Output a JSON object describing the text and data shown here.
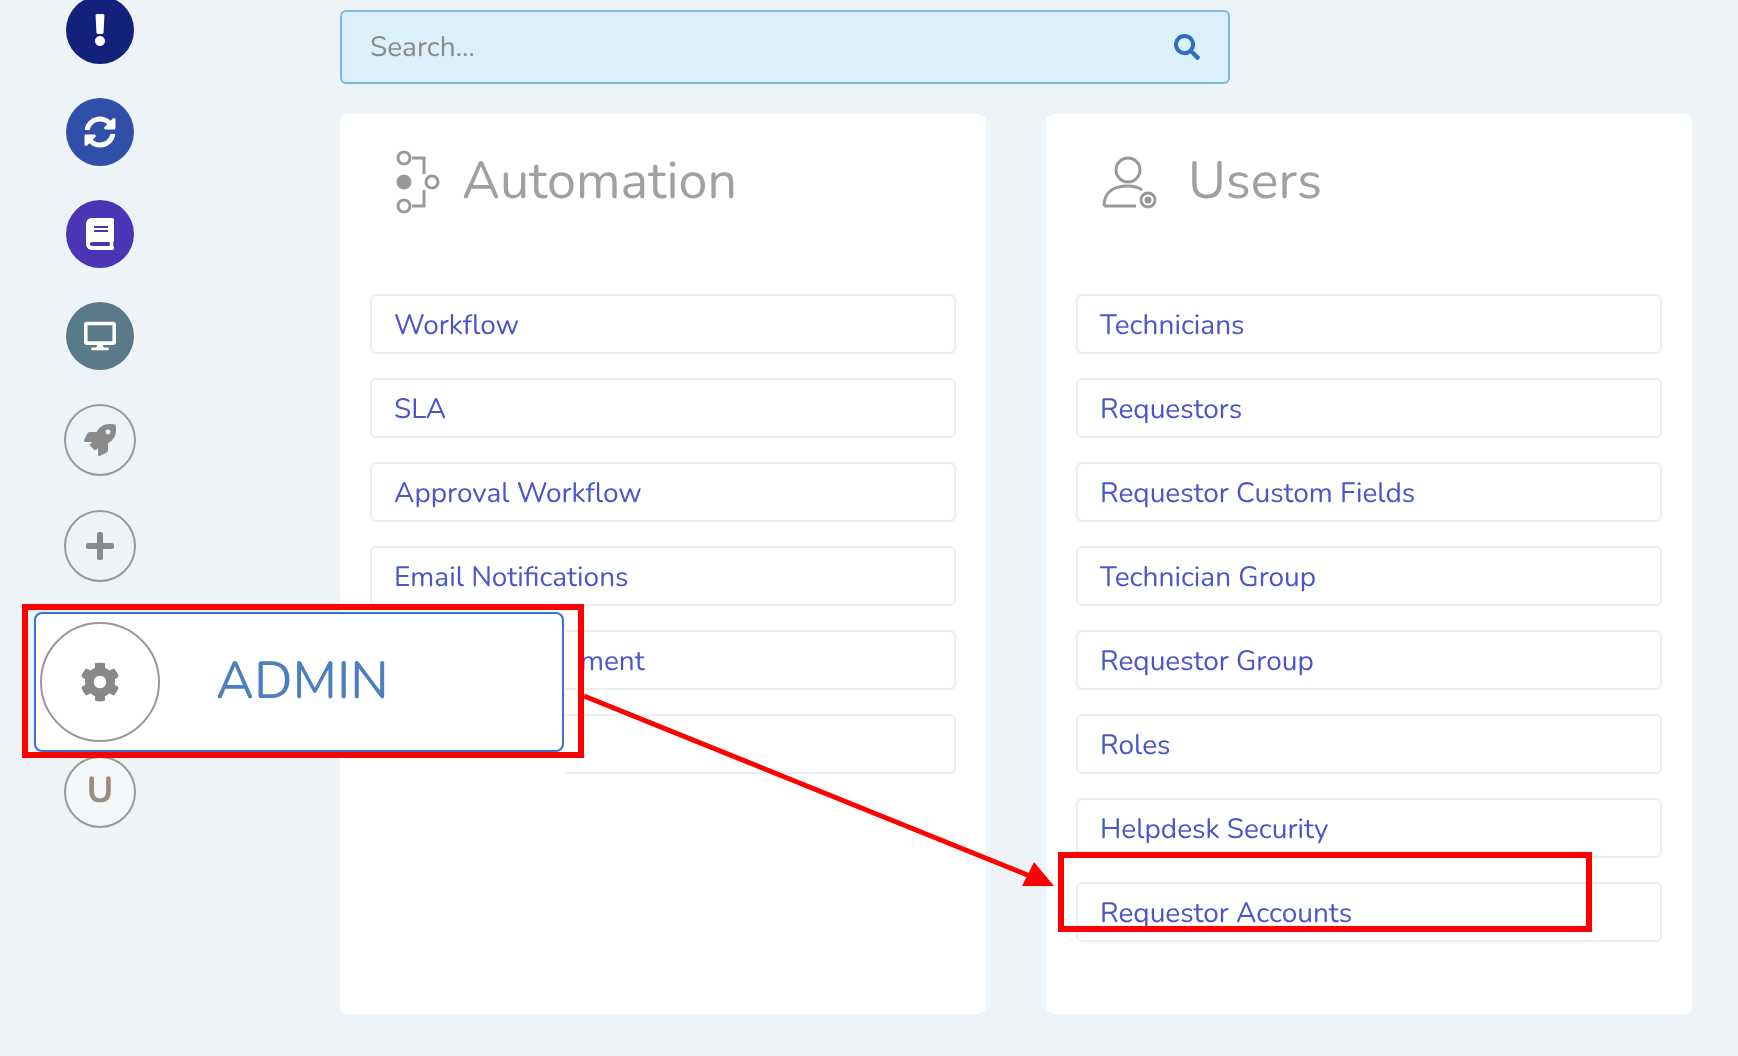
{
  "sidebar": {
    "items": [
      {
        "kind": "filled",
        "color": "#13217a"
      },
      {
        "kind": "filled",
        "color": "#2f4fa8"
      },
      {
        "kind": "filled",
        "color": "#4b35b5"
      },
      {
        "kind": "filled",
        "color": "#5b7a89"
      },
      {
        "kind": "outline"
      },
      {
        "kind": "outline"
      },
      {
        "kind": "letter",
        "text": "U"
      }
    ]
  },
  "search": {
    "placeholder": "Search..."
  },
  "cards": [
    {
      "title": "Automation",
      "items": [
        {
          "kind": "link",
          "label": "Workflow"
        },
        {
          "kind": "link",
          "label": "SLA"
        },
        {
          "kind": "link",
          "label": "Approval Workflow"
        },
        {
          "kind": "link",
          "label": "Email Notifications"
        },
        {
          "kind": "covered",
          "label": "ment"
        },
        {
          "kind": "covered"
        }
      ]
    },
    {
      "title": "Users",
      "items": [
        {
          "kind": "link",
          "label": "Technicians"
        },
        {
          "kind": "link",
          "label": "Requestors"
        },
        {
          "kind": "link",
          "label": "Requestor Custom Fields"
        },
        {
          "kind": "link",
          "label": "Technician Group"
        },
        {
          "kind": "link",
          "label": "Requestor Group"
        },
        {
          "kind": "link",
          "label": "Roles"
        },
        {
          "kind": "link",
          "label": "Helpdesk Security"
        },
        {
          "kind": "link",
          "label": "Requestor Accounts"
        }
      ]
    }
  ],
  "popup": {
    "label": "ADMIN"
  }
}
